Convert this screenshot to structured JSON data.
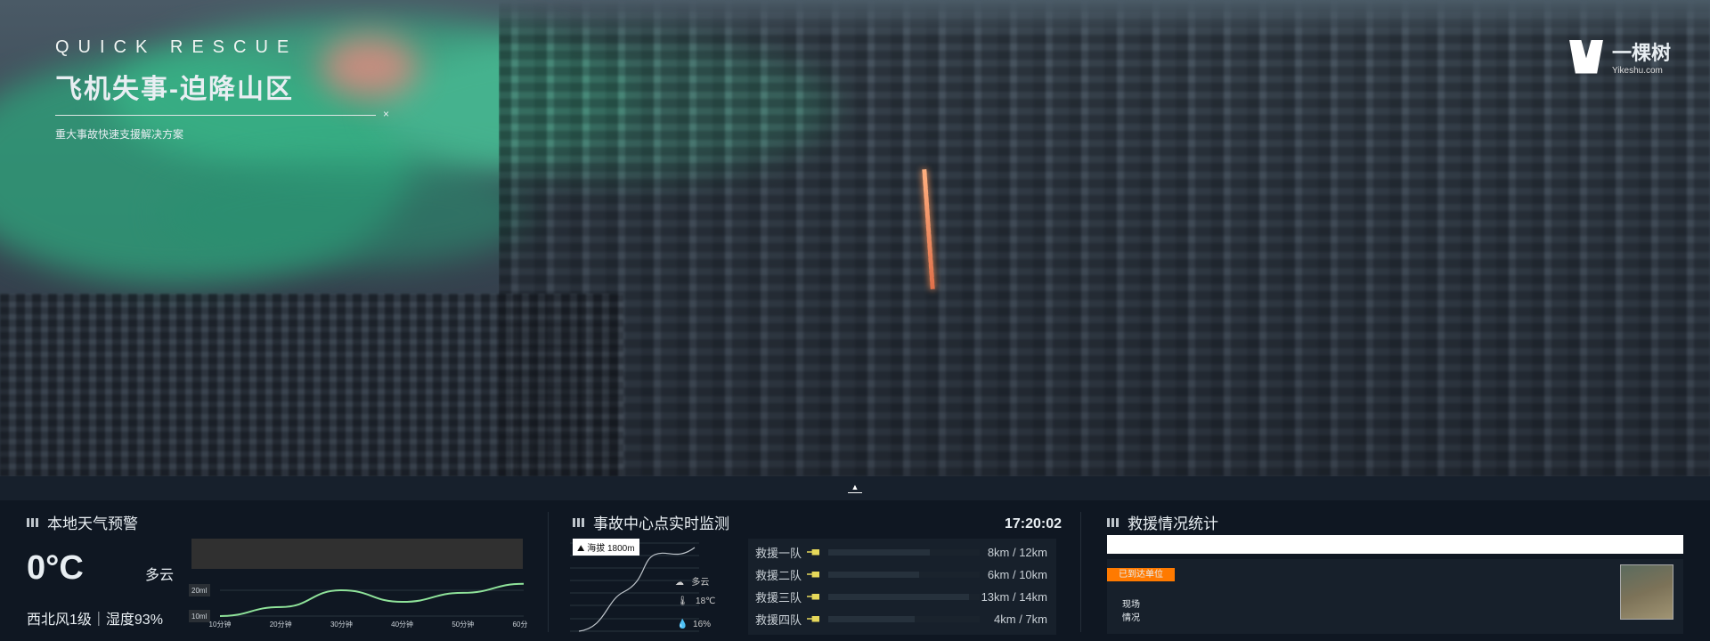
{
  "header": {
    "subtitle_en": "QUICK RESCUE",
    "title": "飞机失事-迫降山区",
    "close_mark": "×",
    "description": "重大事故快速支援解决方案"
  },
  "logo": {
    "name": "一棵树",
    "domain": "Yikeshu.com"
  },
  "toggle": {
    "icon": "caret-up-icon",
    "glyph": "▲"
  },
  "weather": {
    "title": "本地天气预警",
    "temperature": "0°C",
    "condition": "多云",
    "wind_humidity": "西北风1级｜湿度93%",
    "chart_data": {
      "type": "line",
      "x": [
        "10分钟",
        "20分钟",
        "30分钟",
        "40分钟",
        "50分钟",
        "60分钟"
      ],
      "y_labels": [
        "20ml",
        "10ml"
      ],
      "values": [
        10,
        13.5,
        20,
        15.5,
        19,
        22.5
      ],
      "ylim": [
        10,
        20
      ],
      "color": "#8fe39a"
    }
  },
  "monitor": {
    "title": "事故中心点实时监测",
    "time": "17:20:02",
    "altitude": "海拔 1800m",
    "condition": "多云",
    "temperature": "18℃",
    "humidity": "16%",
    "teams": [
      {
        "name": "救援一队",
        "value": "8km / 12km",
        "progress": 0.67
      },
      {
        "name": "救援二队",
        "value": "6km / 10km",
        "progress": 0.6
      },
      {
        "name": "救援三队",
        "value": "13km / 14km",
        "progress": 0.93
      },
      {
        "name": "救援四队",
        "value": "4km /  7km",
        "progress": 0.57
      }
    ]
  },
  "rescue": {
    "title": "救援情况统计",
    "tag": "已到达单位",
    "scene_label_1": "现场",
    "scene_label_2": "情况",
    "colors": {
      "tag": "#ff7a00"
    }
  }
}
